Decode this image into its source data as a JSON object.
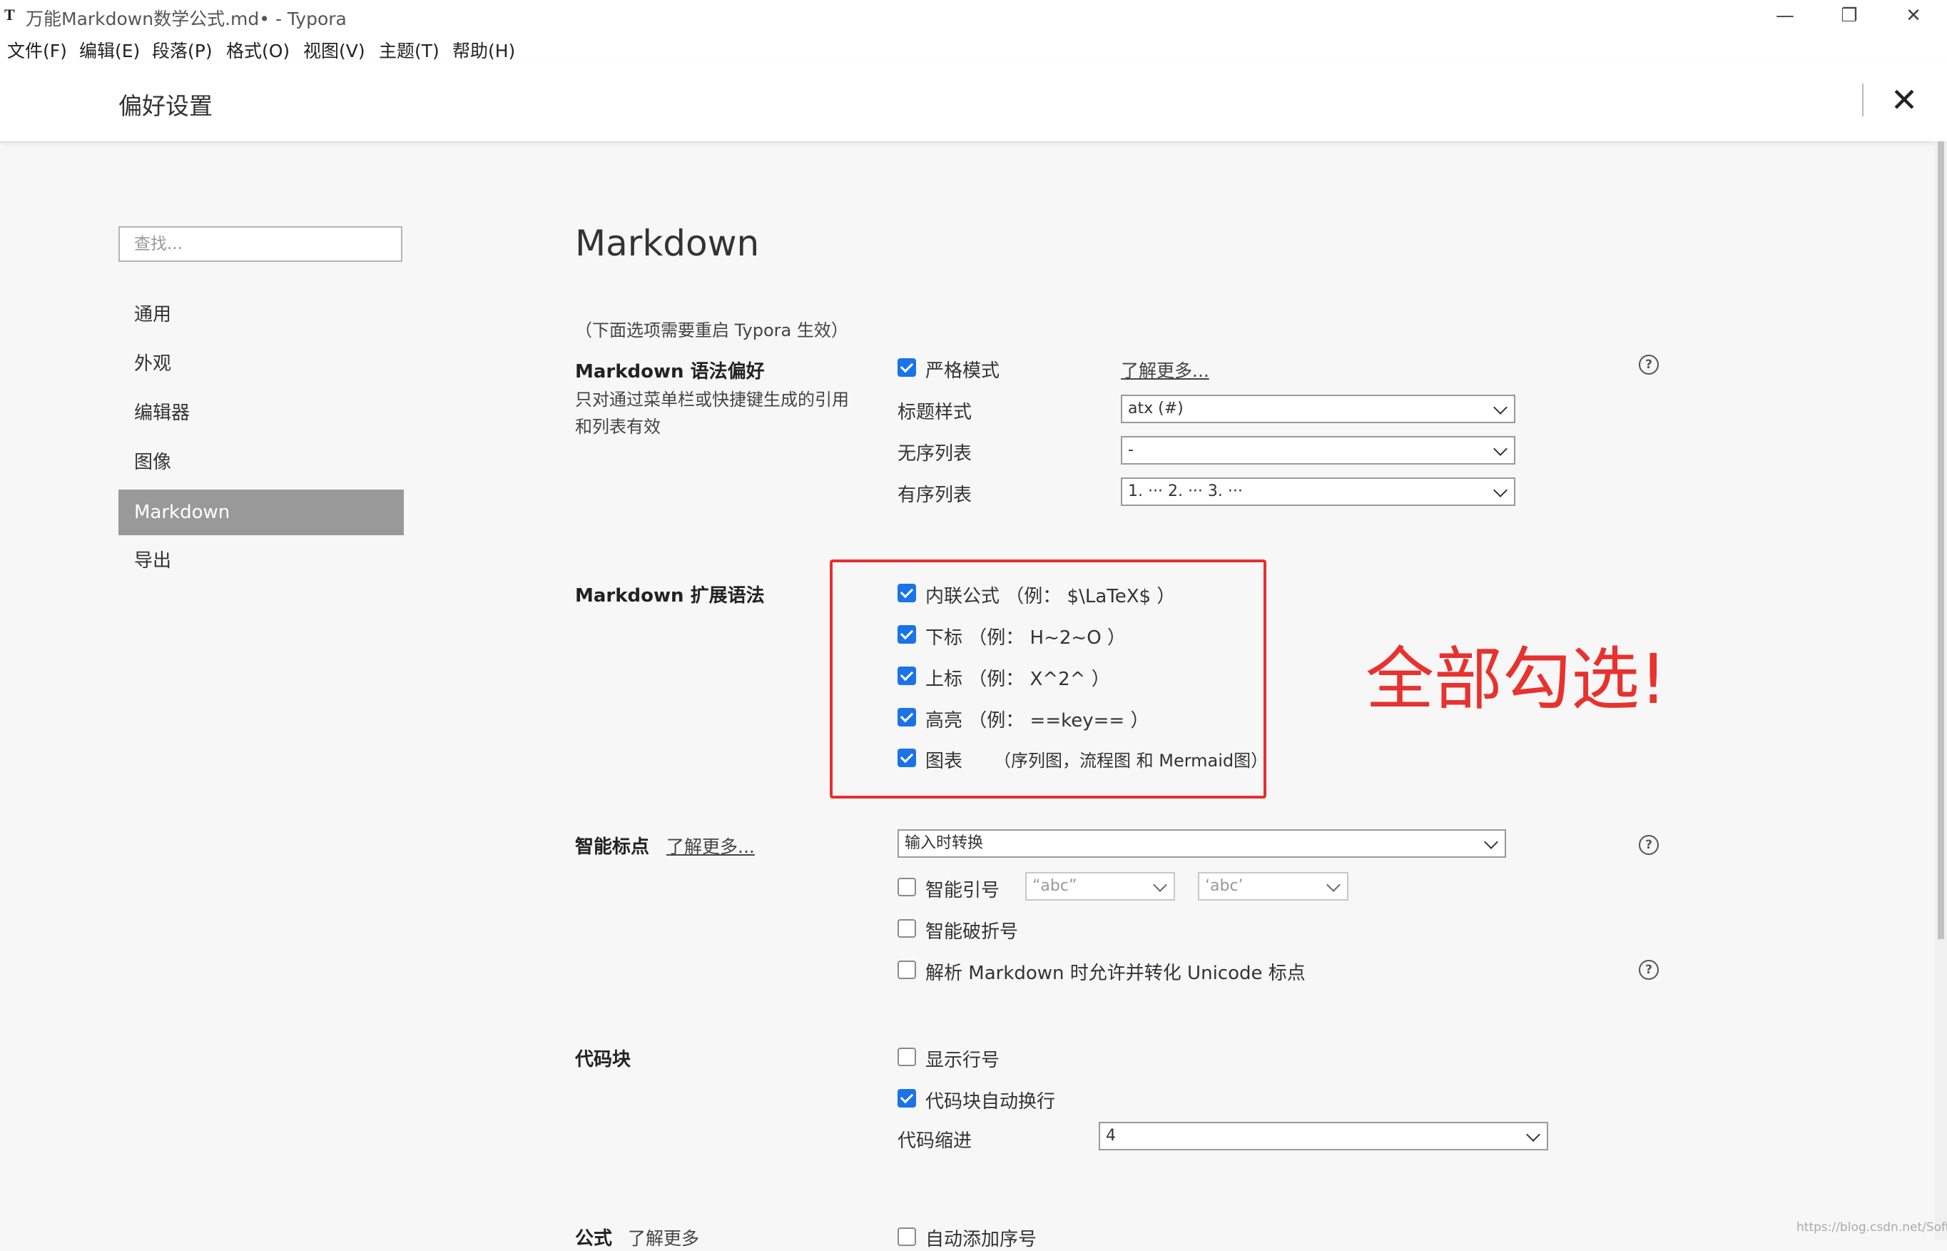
{
  "window": {
    "title": "万能Markdown数学公式.md• - Typora",
    "app_icon": "T",
    "minimize": "—",
    "restore": "❐",
    "close": "✕"
  },
  "menu": [
    "文件(F)",
    "编辑(E)",
    "段落(P)",
    "格式(O)",
    "视图(V)",
    "主题(T)",
    "帮助(H)"
  ],
  "prefs": {
    "title": "偏好设置",
    "close_glyph": "✕",
    "search_placeholder": "查找...",
    "sidebar": [
      {
        "label": "通用",
        "active": false
      },
      {
        "label": "外观",
        "active": false
      },
      {
        "label": "编辑器",
        "active": false
      },
      {
        "label": "图像",
        "active": false
      },
      {
        "label": "Markdown",
        "active": true
      },
      {
        "label": "导出",
        "active": false
      }
    ]
  },
  "main": {
    "heading": "Markdown",
    "restart_note": "（下面选项需要重启 Typora 生效）",
    "syntax_pref": {
      "title": "Markdown 语法偏好",
      "desc": "只对通过菜单栏或快捷键生成的引用和列表有效",
      "strict_mode": {
        "label": "严格模式",
        "checked": true
      },
      "learn_more": "了解更多...",
      "heading_style": {
        "label": "标题样式",
        "value": "atx (#)"
      },
      "unordered_list": {
        "label": "无序列表",
        "value": "-"
      },
      "ordered_list": {
        "label": "有序列表",
        "value": "1. ··· 2. ··· 3. ···"
      }
    },
    "ext_syntax": {
      "title": "Markdown 扩展语法",
      "items": [
        {
          "label": "内联公式 （例： $\\LaTeX$ ）",
          "checked": true
        },
        {
          "label": "下标 （例： H~2~O ）",
          "checked": true
        },
        {
          "label": "上标 （例： X^2^ ）",
          "checked": true
        },
        {
          "label": "高亮 （例： ==key== ）",
          "checked": true
        },
        {
          "label": "图表",
          "checked": true,
          "note": "（序列图，流程图 和 Mermaid图）"
        }
      ]
    },
    "smart_punct": {
      "title": "智能标点",
      "learn_more": "了解更多...",
      "mode": "输入时转换",
      "smart_quotes": {
        "label": "智能引号",
        "checked": false,
        "double": "“abc”",
        "single": "‘abc’"
      },
      "smart_dash": {
        "label": "智能破折号",
        "checked": false
      },
      "unicode": {
        "label": "解析 Markdown 时允许并转化 Unicode 标点",
        "checked": false
      }
    },
    "code_block": {
      "title": "代码块",
      "line_numbers": {
        "label": "显示行号",
        "checked": false
      },
      "auto_wrap": {
        "label": "代码块自动换行",
        "checked": true
      },
      "indent": {
        "label": "代码缩进",
        "value": "4"
      }
    },
    "math": {
      "title": "公式",
      "learn_more": "了解更多",
      "auto_number": {
        "label": "自动添加序号",
        "checked": false
      }
    }
  },
  "annotation": "全部勾选!",
  "watermark": "https://blog.csdn.net/Soft_Po",
  "colors": {
    "accent": "#1a73e8",
    "annotation_red": "#e53030",
    "sidebar_active": "#999999"
  }
}
